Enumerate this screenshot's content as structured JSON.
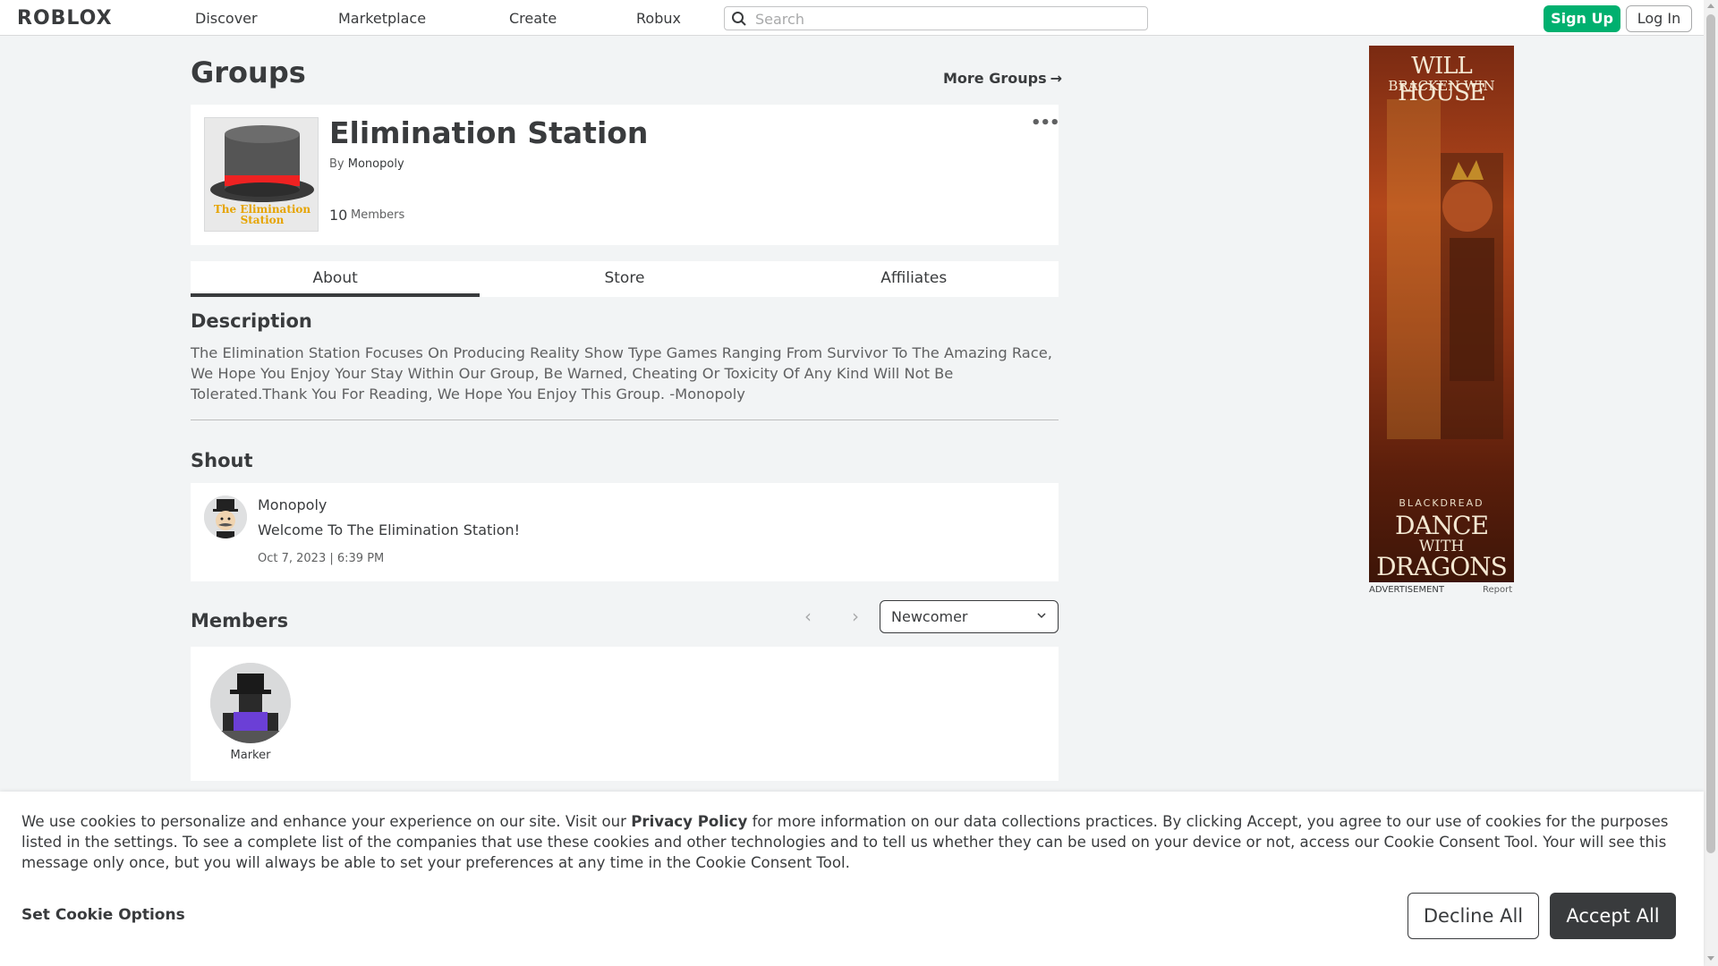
{
  "header": {
    "logo": "ROBLOX",
    "nav": [
      "Discover",
      "Marketplace",
      "Create",
      "Robux"
    ],
    "search_placeholder": "Search",
    "signup_label": "Sign Up",
    "login_label": "Log In"
  },
  "page": {
    "title": "Groups",
    "more_groups_label": "More Groups",
    "more_groups_arrow": "→"
  },
  "group": {
    "name": "Elimination Station",
    "by_prefix": "By",
    "owner": "Monopoly",
    "member_count": "10",
    "member_label": "Members",
    "more_menu": "•••",
    "thumb_text": "The Elimination Station"
  },
  "tabs": [
    "About",
    "Store",
    "Affiliates"
  ],
  "about": {
    "description_heading": "Description",
    "description": "The Elimination Station Focuses On Producing Reality Show Type Games Ranging From Survivor To The Amazing Race, We Hope You Enjoy Your Stay Within Our Group, Be Warned, Cheating Or Toxicity Of Any Kind Will Not Be Tolerated.Thank You For Reading, We Hope You Enjoy This Group. -Monopoly",
    "shout_heading": "Shout",
    "shout": {
      "author": "Monopoly",
      "message": "Welcome To The Elimination Station!",
      "time": "Oct 7, 2023 | 6:39 PM"
    },
    "members_heading": "Members",
    "role_selected": "Newcomer",
    "members": [
      {
        "name": "Marker"
      }
    ]
  },
  "ad": {
    "top_line1": "WILL HOUSE",
    "top_line2": "BRACKEN WIN",
    "bottom_line1": "BLACKDREAD",
    "bottom_line2": "DANCE",
    "bottom_line3": "WITH",
    "bottom_line4": "DRAGONS",
    "label": "ADVERTISEMENT",
    "report": "Report"
  },
  "cookie": {
    "text_before": "We use cookies to personalize and enhance your experience on our site. Visit our ",
    "privacy_link": "Privacy Policy",
    "text_after": " for more information on our data collections practices. By clicking Accept, you agree to our use of cookies for the purposes listed in the settings. To see a complete list of the companies that use these cookies and other technologies and to tell us whether they can be used on your device or not, access our Cookie Consent Tool. Your will see this message only once, but you will always be able to set your preferences at any time in the Cookie Consent Tool.",
    "options_label": "Set Cookie Options",
    "decline_label": "Decline All",
    "accept_label": "Accept All"
  },
  "colors": {
    "accent_green": "#00b06f",
    "text_dark": "#393b3d",
    "background": "#f2f4f5"
  }
}
